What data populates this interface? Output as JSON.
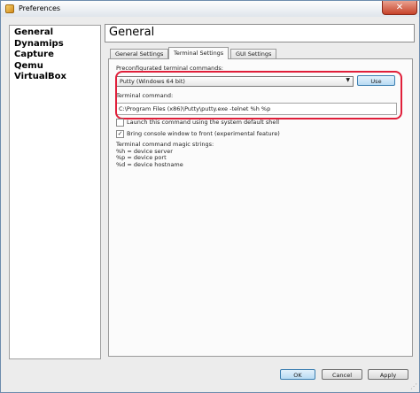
{
  "window": {
    "title": "Preferences",
    "close_glyph": "✕"
  },
  "sidebar": {
    "items": [
      {
        "label": "General"
      },
      {
        "label": "Dynamips"
      },
      {
        "label": "Capture"
      },
      {
        "label": "Qemu"
      },
      {
        "label": "VirtualBox"
      }
    ]
  },
  "header": {
    "title": "General"
  },
  "tabs": [
    {
      "label": "General Settings",
      "active": false
    },
    {
      "label": "Terminal Settings",
      "active": true
    },
    {
      "label": "GUI Settings",
      "active": false
    }
  ],
  "terminal": {
    "preconfigured_label": "Preconfigurated terminal commands:",
    "preconfigured_value": "Putty (Windows 64 bit)",
    "use_button": "Use",
    "command_label": "Terminal command:",
    "command_value": "C:\\Program Files (x86)\\Putty\\putty.exe -telnet %h %p",
    "launch_checkbox": {
      "label": "Launch this command using the system default shell",
      "checked": false
    },
    "front_checkbox": {
      "label": "Bring console window to front (experimental feature)",
      "checked": true
    },
    "magic_title": "Terminal command magic strings:",
    "magic_lines": [
      "%h = device server",
      "%p = device port",
      "%d = device hostname"
    ]
  },
  "footer": {
    "ok": "OK",
    "cancel": "Cancel",
    "apply": "Apply"
  },
  "colors": {
    "highlight_ring": "#e01f3a",
    "accent_button": "#b8daf3"
  }
}
